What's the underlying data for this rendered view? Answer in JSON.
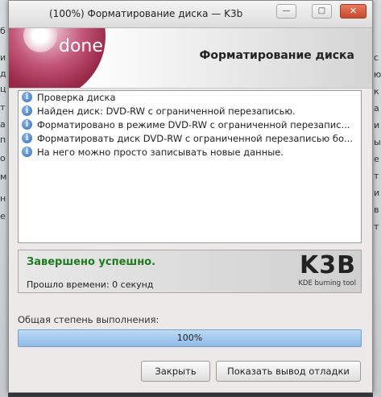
{
  "window": {
    "title": "(100%) Форматирование диска — K3b",
    "min_glyph": "—",
    "max_glyph": "□",
    "close_glyph": "✕"
  },
  "header": {
    "badge": "done",
    "title": "Форматирование диска"
  },
  "log": [
    {
      "icon": "info-icon",
      "text": "Проверка диска"
    },
    {
      "icon": "info-icon",
      "text": "Найден диск: DVD-RW с ограниченной перезаписью."
    },
    {
      "icon": "info-icon",
      "text": "Форматировано в режиме DVD-RW с ограниченной перезапис..."
    },
    {
      "icon": "info-icon",
      "text": "Форматировать диск DVD-RW с ограниченной перезаписью бо..."
    },
    {
      "icon": "info-icon",
      "text": "На него можно просто записывать новые данные."
    }
  ],
  "status": {
    "result": "Завершено успешно.",
    "elapsed": "Прошло времени: 0 секунд",
    "logo_big": "K3B",
    "logo_small": "KDE burning tool",
    "result_color": "#1f7a1f"
  },
  "progress": {
    "label": "Общая степень выполнения:",
    "value": 100,
    "text": "100%"
  },
  "buttons": {
    "close": "Закрыть",
    "debug": "Показать вывод отладки"
  },
  "background": {
    "left_fragments": [
      "б",
      "и",
      "д",
      "ц",
      "т",
      "а",
      "п",
      "о",
      "м",
      "н",
      "е"
    ],
    "right_fragments": [
      "с",
      "ю",
      "к",
      "а",
      "и",
      "ы",
      "е",
      "т",
      "и",
      "в",
      "т"
    ]
  }
}
